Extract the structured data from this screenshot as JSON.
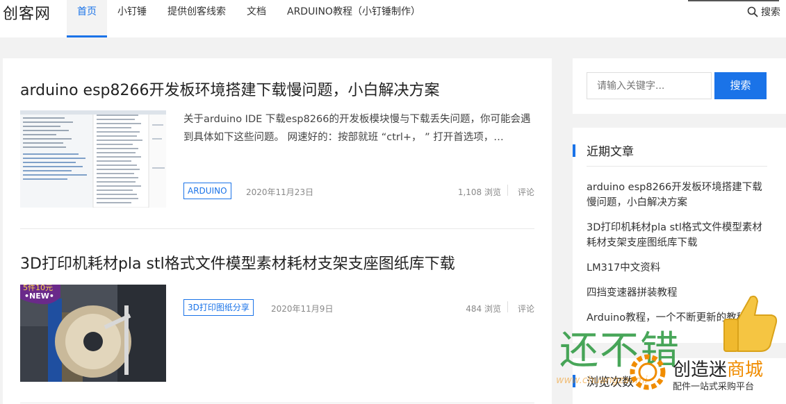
{
  "site": {
    "logo": "创客网"
  },
  "nav": [
    {
      "label": "首页",
      "active": true
    },
    {
      "label": "小钉锤"
    },
    {
      "label": "提供创客线索"
    },
    {
      "label": "文档"
    },
    {
      "label": "ARDUINO教程（小钉锤制作）"
    }
  ],
  "top_search": {
    "label": "搜索"
  },
  "posts": [
    {
      "title": "arduino esp8266开发板环境搭建下载慢问题，小白解决方案",
      "excerpt": "关于arduino IDE 下载esp8266的开发板模块慢与下载丢失问题，你可能会遇到具体如下这些问题。 网速好的：按部就班 “ctrl+， ” 打开首选项，…",
      "tag": "ARDUINO",
      "date": "2020年11月23日",
      "views": "1,108 浏览",
      "comments": "评论"
    },
    {
      "title": "3D打印机耗材pla stl格式文件模型素材耗材支架支座图纸库下载",
      "thumb_badge_top": "5件10元",
      "thumb_badge": "•NEW•",
      "tag": "3D打印图纸分享",
      "date": "2020年11月9日",
      "views": "484 浏览",
      "comments": "评论"
    }
  ],
  "sidebar": {
    "search": {
      "placeholder": "请输入关键字...",
      "button": "搜索"
    },
    "recent": {
      "heading": "近期文章",
      "items": [
        "arduino esp8266开发板环境搭建下载慢问题，小白解决方案",
        "3D打印机耗材pla stl格式文件模型素材耗材支架支座图纸库下载",
        "LM317中文资料",
        "四挡变速器拼装教程",
        "Arduino教程，一个不断更新的教程"
      ]
    },
    "views_heading": "浏览次数"
  },
  "watermark": {
    "big": "还不错",
    "brand_main": "创造迷",
    "brand_accent": "商城",
    "sub": "配件一站式采购平台",
    "url": "www.chuangzaomi"
  },
  "colors": {
    "accent": "#1a73e8",
    "watermark_green": "#28963c",
    "watermark_orange": "#f08c00"
  }
}
